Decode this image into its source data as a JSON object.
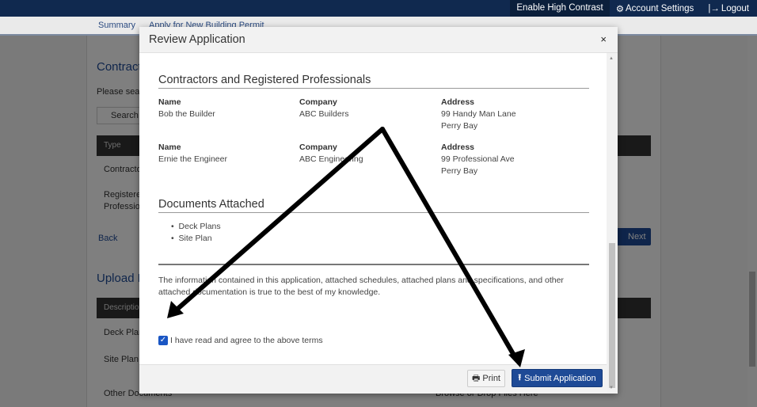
{
  "topbar": {
    "high_contrast": "Enable High Contrast",
    "account_settings": "Account Settings",
    "logout": "Logout"
  },
  "subnav": {
    "items": [
      "Summary",
      "Apply for New Building Permit"
    ]
  },
  "background": {
    "contractors_heading": "Contract",
    "please_search": "Please sear",
    "search_placeholder": "Search",
    "type_header": "Type",
    "rows": [
      "Contracto",
      "Registere",
      "Professio"
    ],
    "back": "Back",
    "next": "Next",
    "upload_heading": "Upload D",
    "desc_header": "Description",
    "doc_rows": [
      "Deck Plan",
      "Site Plan",
      "Other Documents"
    ],
    "browse": "Browse or Drop Files Here"
  },
  "modal": {
    "title": "Review Application",
    "close": "×",
    "contractors_heading": "Contractors and Registered Professionals",
    "labels": {
      "name": "Name",
      "company": "Company",
      "address": "Address"
    },
    "contractors": [
      {
        "name": "Bob the Builder",
        "company": "ABC Builders",
        "address1": "99 Handy Man Lane",
        "address2": "Perry Bay"
      },
      {
        "name": "Ernie the Engineer",
        "company": "ABC Engineering",
        "address1": "99 Professional Ave",
        "address2": "Perry Bay"
      }
    ],
    "documents_heading": "Documents Attached",
    "documents": [
      "Deck Plans",
      "Site Plan"
    ],
    "declaration": "The information contained in this application, attached schedules, attached plans and specifications, and other attached documentation is true to the best of my knowledge.",
    "agree_label": "I have read and agree to the above terms",
    "agree_checked": true,
    "print": "Print",
    "submit": "Submit Application"
  },
  "colors": {
    "navy": "#10294f",
    "primary": "#1e4a96",
    "arrow": "#000000"
  }
}
